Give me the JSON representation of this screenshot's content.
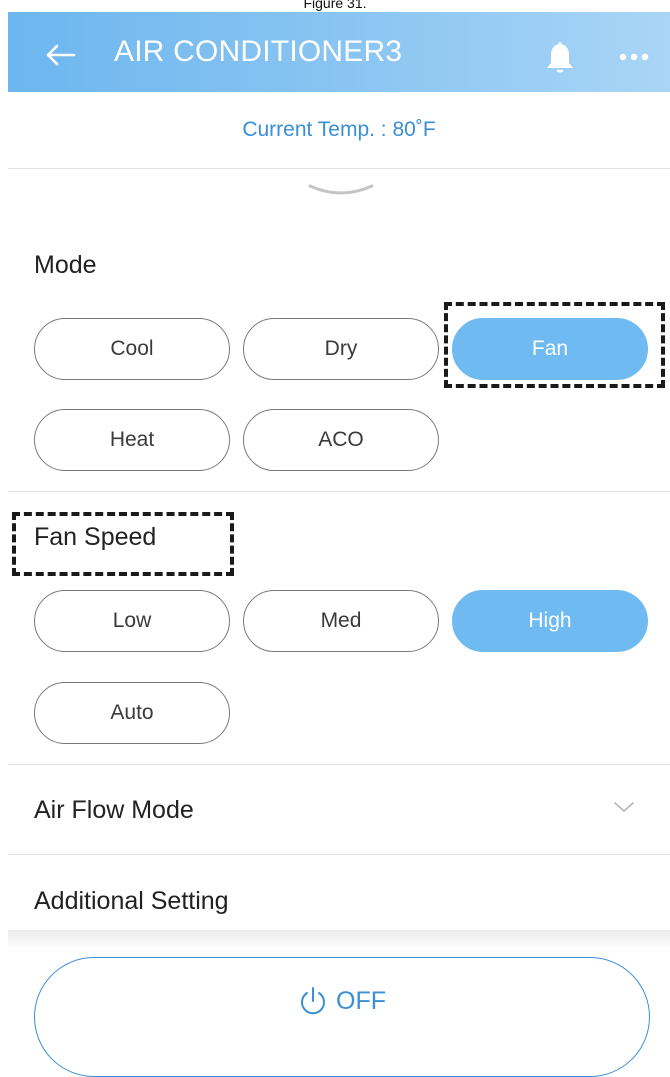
{
  "caption": "Figure 31.",
  "header": {
    "title": "AIR CONDITIONER3"
  },
  "status": {
    "current_temp": "Current Temp. : 80˚F"
  },
  "mode": {
    "title": "Mode",
    "options": [
      "Cool",
      "Dry",
      "Fan",
      "Heat",
      "ACO"
    ],
    "selected": "Fan"
  },
  "fan_speed": {
    "title": "Fan Speed",
    "options": [
      "Low",
      "Med",
      "High",
      "Auto"
    ],
    "selected": "High"
  },
  "air_flow": {
    "label": "Air Flow Mode"
  },
  "additional": {
    "label": "Additional Setting"
  },
  "power": {
    "label": "OFF"
  },
  "colors": {
    "header_gradient_start": "#6db6ef",
    "accent": "#3a8fd6",
    "selected_fill": "#6fbaf1",
    "outline": "#7a7a7a"
  },
  "icons": [
    "back-arrow-icon",
    "bell-icon",
    "more-icon",
    "chevron-down-icon",
    "power-icon"
  ]
}
